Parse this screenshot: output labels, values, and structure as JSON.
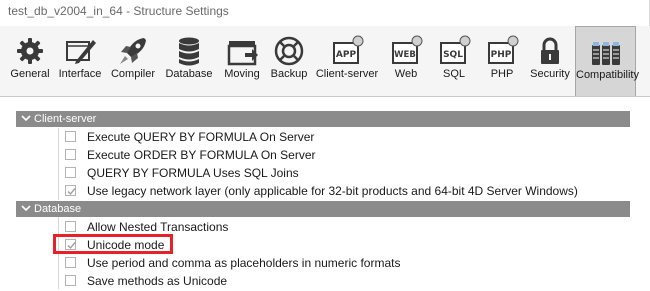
{
  "window": {
    "title": "test_db_v2004_in_64 - Structure Settings"
  },
  "toolbar": {
    "items": [
      {
        "label": "General",
        "icon": "gear-icon"
      },
      {
        "label": "Interface",
        "icon": "interface-pencil-icon"
      },
      {
        "label": "Compiler",
        "icon": "rocket-icon"
      },
      {
        "label": "Database",
        "icon": "database-icon"
      },
      {
        "label": "Moving",
        "icon": "moving-box-icon"
      },
      {
        "label": "Backup",
        "icon": "lifebuoy-icon"
      },
      {
        "label": "Client-server",
        "icon": "app-window-icon"
      },
      {
        "label": "Web",
        "icon": "web-icon"
      },
      {
        "label": "SQL",
        "icon": "sql-icon"
      },
      {
        "label": "PHP",
        "icon": "php-icon"
      },
      {
        "label": "Security",
        "icon": "padlock-icon"
      },
      {
        "label": "Compatibility",
        "icon": "compatibility-icon"
      }
    ],
    "active": "Compatibility",
    "icon_labels": {
      "app": "APP",
      "web": "WEB",
      "sql": "SQL",
      "php": "PHP"
    }
  },
  "sections": [
    {
      "title": "Client-server",
      "options": [
        {
          "label": "Execute QUERY BY FORMULA On Server",
          "checked": false
        },
        {
          "label": "Execute ORDER BY FORMULA On Server",
          "checked": false
        },
        {
          "label": "QUERY BY FORMULA Uses SQL Joins",
          "checked": false
        },
        {
          "label": "Use legacy network layer (only applicable for 32-bit products and 64-bit 4D Server Windows)",
          "checked": true
        }
      ]
    },
    {
      "title": "Database",
      "options": [
        {
          "label": "Allow Nested Transactions",
          "checked": false
        },
        {
          "label": "Unicode mode",
          "checked": true
        },
        {
          "label": "Use period and comma as placeholders in numeric formats",
          "checked": false
        },
        {
          "label": "Save methods as Unicode",
          "checked": false
        }
      ]
    }
  ],
  "colors": {
    "highlight": "#e8202a",
    "section_header": "#8b8b8b",
    "toolbar_bg": "#f5f5f5",
    "active_tab_bg": "#d6d6d6"
  }
}
